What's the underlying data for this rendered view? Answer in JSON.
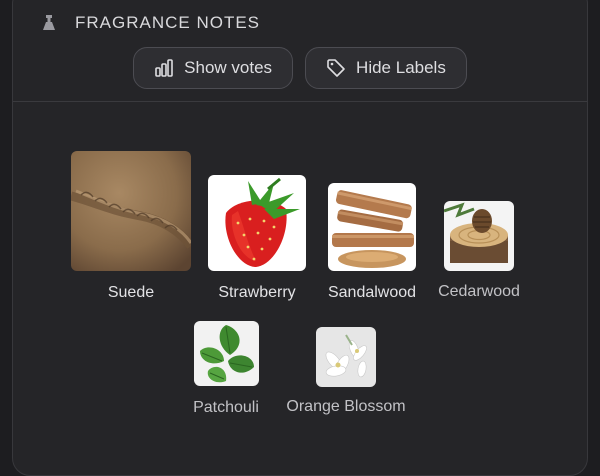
{
  "section": {
    "title": "FRAGRANCE NOTES",
    "icon": "perfume-bottle-icon"
  },
  "buttons": {
    "show_votes": {
      "label": "Show votes",
      "icon": "bar-chart-icon"
    },
    "hide_labels": {
      "label": "Hide Labels",
      "icon": "tag-icon"
    }
  },
  "notes_row1": [
    {
      "name": "Suede",
      "image": "suede-leather-image"
    },
    {
      "name": "Strawberry",
      "image": "strawberry-image"
    },
    {
      "name": "Sandalwood",
      "image": "sandalwood-image"
    },
    {
      "name": "Cedarwood",
      "image": "cedarwood-image"
    }
  ],
  "notes_row2": [
    {
      "name": "Patchouli",
      "image": "patchouli-leaves-image"
    },
    {
      "name": "Orange Blossom",
      "image": "orange-blossom-image"
    }
  ],
  "colors": {
    "background": "#1d1d20",
    "card": "#252528",
    "button_border": "#4c4c52",
    "text": "#e2e2e5"
  }
}
